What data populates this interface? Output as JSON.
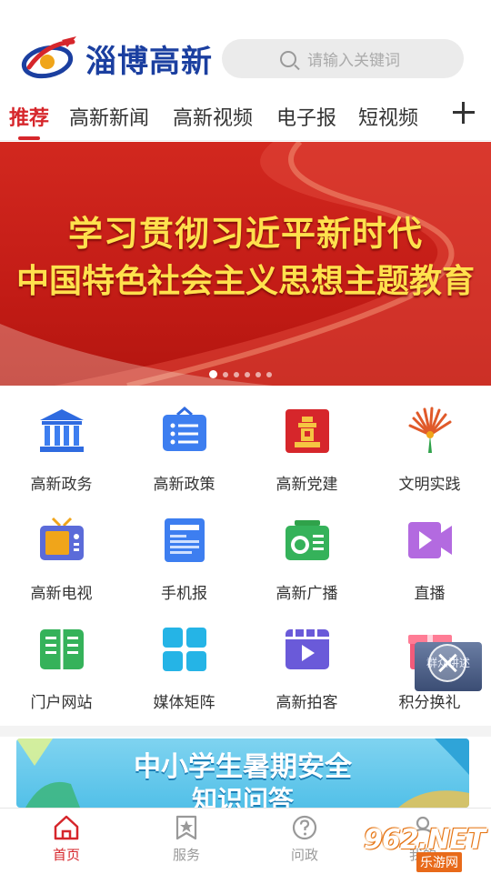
{
  "app": {
    "logo_text": "淄博高新",
    "brand_color": "#1b3fa0",
    "accent_color": "#d6262b"
  },
  "search": {
    "placeholder": "请输入关键词",
    "icon": "search-icon"
  },
  "tabs": [
    {
      "label": "推荐",
      "active": true
    },
    {
      "label": "高新新闻",
      "active": false
    },
    {
      "label": "高新视频",
      "active": false
    },
    {
      "label": "电子报",
      "active": false
    },
    {
      "label": "短视频",
      "active": false
    }
  ],
  "tab_add_icon": "plus-icon",
  "banner": {
    "line1": "学习贯彻习近平新时代",
    "line2": "中国特色社会主义思想主题教育",
    "slide_count": 6,
    "active_slide": 1
  },
  "services": [
    {
      "label": "高新政务",
      "icon": "government-building-icon"
    },
    {
      "label": "高新政策",
      "icon": "policy-board-icon"
    },
    {
      "label": "高新党建",
      "icon": "party-building-icon"
    },
    {
      "label": "文明实践",
      "icon": "civilization-practice-icon"
    },
    {
      "label": "高新电视",
      "icon": "tv-icon"
    },
    {
      "label": "手机报",
      "icon": "mobile-newspaper-icon"
    },
    {
      "label": "高新广播",
      "icon": "radio-icon"
    },
    {
      "label": "直播",
      "icon": "live-video-icon"
    },
    {
      "label": "门户网站",
      "icon": "portal-book-icon"
    },
    {
      "label": "媒体矩阵",
      "icon": "media-matrix-icon"
    },
    {
      "label": "高新拍客",
      "icon": "video-clip-icon"
    },
    {
      "label": "积分换礼",
      "icon": "gift-icon"
    }
  ],
  "promo": {
    "line1": "中小学生暑期安全",
    "line2": "知识问答"
  },
  "float_ad": {
    "text": "群众讲述"
  },
  "bottom_nav": [
    {
      "label": "首页",
      "icon": "home-icon",
      "active": true
    },
    {
      "label": "服务",
      "icon": "service-star-icon",
      "active": false
    },
    {
      "label": "问政",
      "icon": "question-icon",
      "active": false
    },
    {
      "label": "我的",
      "icon": "user-icon",
      "active": false
    }
  ],
  "watermark": {
    "top": "962.NET",
    "bottom": "乐游网"
  }
}
